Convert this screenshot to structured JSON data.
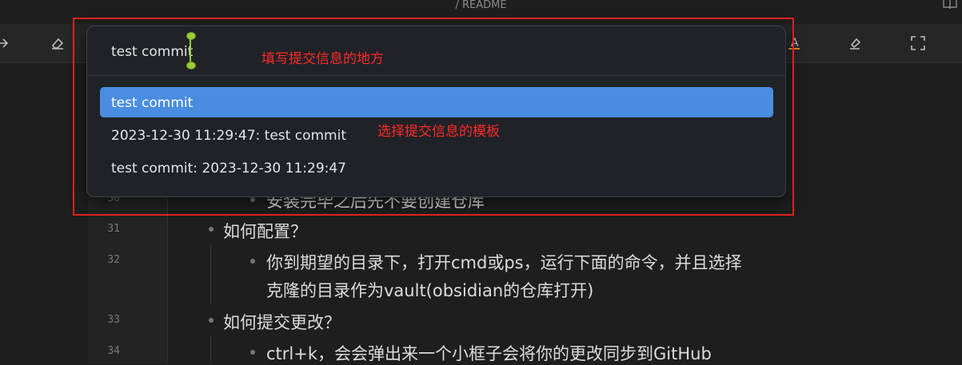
{
  "breadcrumb": "/ README",
  "editor": {
    "lines": [
      {
        "number": "30",
        "text": "安装完毕之后先不要创建仓库"
      },
      {
        "number": "31",
        "text": "如何配置？"
      },
      {
        "number": "32",
        "text": "你到期望的目录下，打开cmd或ps，运行下面的命令，并且选择"
      },
      {
        "number": "",
        "text": "克隆的目录作为vault(obsidian的仓库打开)"
      },
      {
        "number": "33",
        "text": "如何提交更改？"
      },
      {
        "number": "34",
        "text": "ctrl+k，会会弹出来一个小框子会将你的更改同步到GitHub"
      }
    ]
  },
  "palette": {
    "input_value": "test commit",
    "suggestions": [
      {
        "label": "test commit",
        "selected": true
      },
      {
        "label": "2023-12-30 11:29:47: test commit",
        "selected": false
      },
      {
        "label": "test commit: 2023-12-30 11:29:47",
        "selected": false
      }
    ]
  },
  "annotations": {
    "input_note": "填写提交信息的地方",
    "template_note": "选择提交信息的模板"
  },
  "colors": {
    "accent": "#4a8de0",
    "annotation": "#ff2a2a",
    "caret": "#9acd32"
  },
  "icons": [
    "redo-icon",
    "eraser-icon",
    "font-color-icon",
    "highlighter-icon",
    "fullscreen-icon",
    "book-icon"
  ]
}
